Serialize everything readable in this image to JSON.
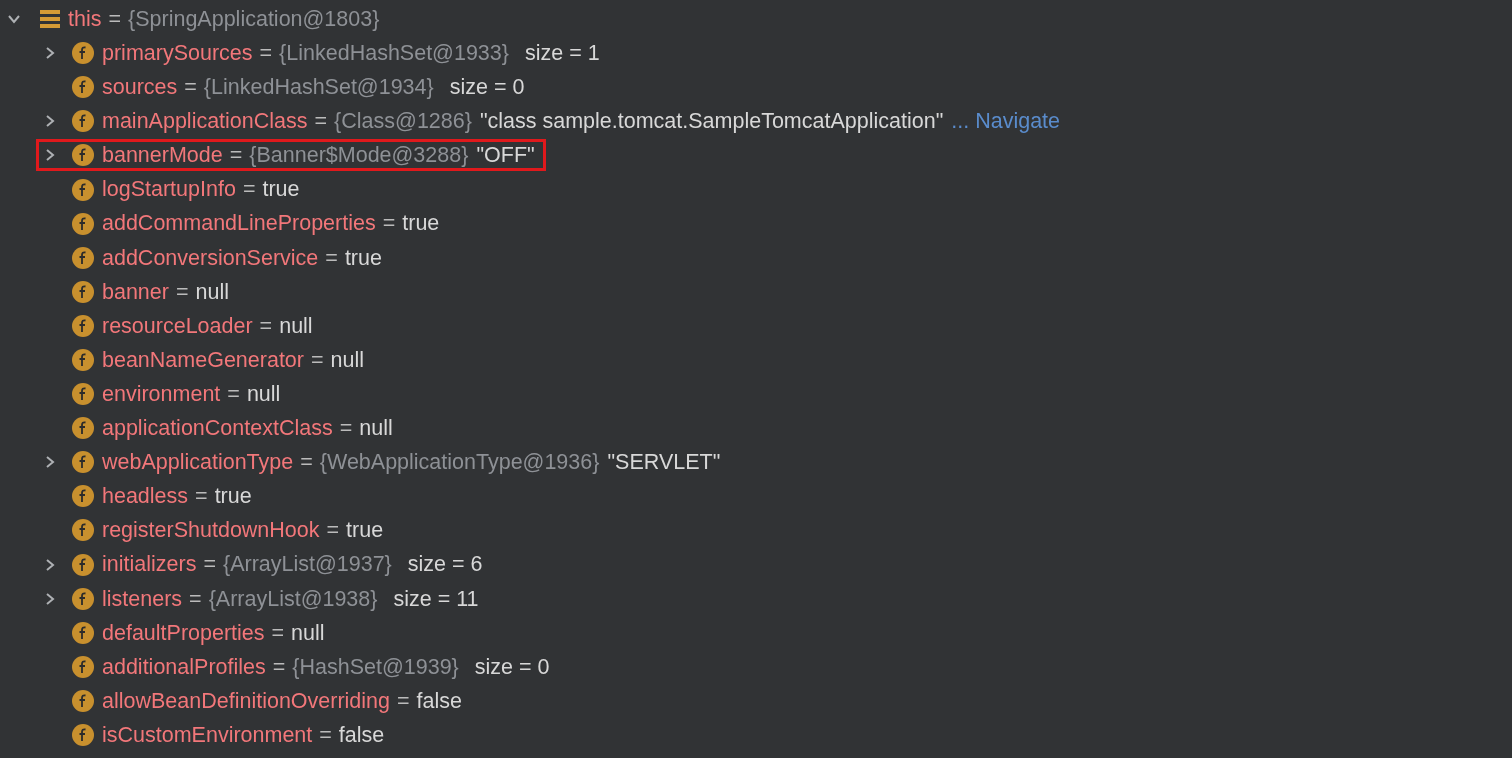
{
  "root": {
    "name": "this",
    "equals": "=",
    "type": "{SpringApplication@1803}",
    "expanded": true,
    "children": [
      {
        "name": "primarySources",
        "equals": "=",
        "type": "{LinkedHashSet@1933}",
        "size": "size = 1",
        "expandable": true,
        "highlighted": false
      },
      {
        "name": "sources",
        "equals": "=",
        "type": "{LinkedHashSet@1934}",
        "size": "size = 0",
        "expandable": false,
        "highlighted": false
      },
      {
        "name": "mainApplicationClass",
        "equals": "=",
        "type": "{Class@1286}",
        "value": "\"class sample.tomcat.SampleTomcatApplication\"",
        "more": "...",
        "link": "Navigate",
        "expandable": true,
        "highlighted": false
      },
      {
        "name": "bannerMode",
        "equals": "=",
        "type": "{Banner$Mode@3288}",
        "value": "\"OFF\"",
        "expandable": true,
        "highlighted": true
      },
      {
        "name": "logStartupInfo",
        "equals": "=",
        "value": "true",
        "expandable": false,
        "highlighted": false
      },
      {
        "name": "addCommandLineProperties",
        "equals": "=",
        "value": "true",
        "expandable": false,
        "highlighted": false
      },
      {
        "name": "addConversionService",
        "equals": "=",
        "value": "true",
        "expandable": false,
        "highlighted": false
      },
      {
        "name": "banner",
        "equals": "=",
        "value": "null",
        "expandable": false,
        "highlighted": false
      },
      {
        "name": "resourceLoader",
        "equals": "=",
        "value": "null",
        "expandable": false,
        "highlighted": false
      },
      {
        "name": "beanNameGenerator",
        "equals": "=",
        "value": "null",
        "expandable": false,
        "highlighted": false
      },
      {
        "name": "environment",
        "equals": "=",
        "value": "null",
        "expandable": false,
        "highlighted": false
      },
      {
        "name": "applicationContextClass",
        "equals": "=",
        "value": "null",
        "expandable": false,
        "highlighted": false
      },
      {
        "name": "webApplicationType",
        "equals": "=",
        "type": "{WebApplicationType@1936}",
        "value": "\"SERVLET\"",
        "expandable": true,
        "highlighted": false
      },
      {
        "name": "headless",
        "equals": "=",
        "value": "true",
        "expandable": false,
        "highlighted": false
      },
      {
        "name": "registerShutdownHook",
        "equals": "=",
        "value": "true",
        "expandable": false,
        "highlighted": false
      },
      {
        "name": "initializers",
        "equals": "=",
        "type": "{ArrayList@1937}",
        "size": "size = 6",
        "expandable": true,
        "highlighted": false
      },
      {
        "name": "listeners",
        "equals": "=",
        "type": "{ArrayList@1938}",
        "size": "size = 11",
        "expandable": true,
        "highlighted": false
      },
      {
        "name": "defaultProperties",
        "equals": "=",
        "value": "null",
        "expandable": false,
        "highlighted": false
      },
      {
        "name": "additionalProfiles",
        "equals": "=",
        "type": "{HashSet@1939}",
        "size": "size = 0",
        "expandable": false,
        "highlighted": false
      },
      {
        "name": "allowBeanDefinitionOverriding",
        "equals": "=",
        "value": "false",
        "expandable": false,
        "highlighted": false
      },
      {
        "name": "isCustomEnvironment",
        "equals": "=",
        "value": "false",
        "expandable": false,
        "highlighted": false
      }
    ]
  }
}
